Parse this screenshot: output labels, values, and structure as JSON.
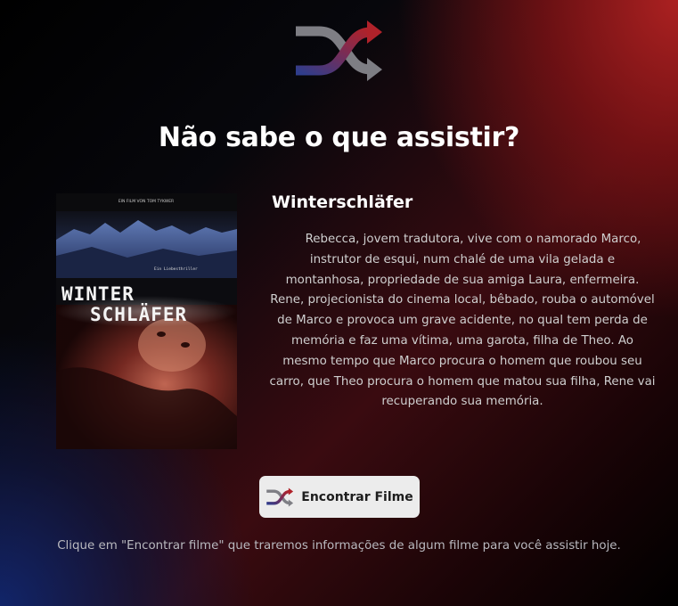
{
  "header": {
    "logo_icon": "shuffle-icon",
    "title": "Não sabe o que assistir?"
  },
  "movie": {
    "title": "Winterschläfer",
    "overview": "Rebecca, jovem tradutora, vive com o namorado Marco, instrutor de esqui, num chalé de uma vila gelada e montanhosa, propriedade de sua amiga Laura, enfermeira. Rene, projecionista do cinema local, bêbado, rouba o automóvel de Marco e provoca um grave acidente, no qual tem perda de memória e faz uma vítima, uma garota, filha de Theo. Ao mesmo tempo que Marco procura o homem que roubou seu carro, que Theo procura o homem que matou sua filha, Rene vai recuperando sua memória.",
    "poster": {
      "credit": "EIN FILM VON TOM TYKWER",
      "tagline": "Ein Liebesthriller",
      "title_line1": "WINTER",
      "title_line2": "SCHLÄFER"
    }
  },
  "actions": {
    "find_button_icon": "shuffle-icon",
    "find_button_label": "Encontrar Filme"
  },
  "footer": {
    "hint": "Clique em \"Encontrar filme\" que traremos informações de algum filme para você assistir hoje."
  },
  "colors": {
    "icon_red": "#a8242c",
    "icon_blue": "#2f3d8c",
    "icon_gray": "#7e7e84",
    "button_bg": "#ececec",
    "text_light": "#cfcfcf"
  }
}
